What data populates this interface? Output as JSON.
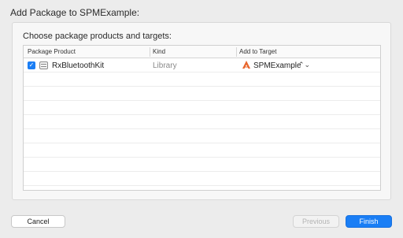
{
  "window": {
    "title": "Add Package to SPMExample:"
  },
  "panel": {
    "heading": "Choose package products and targets:"
  },
  "table": {
    "columns": {
      "product": "Package Product",
      "kind": "Kind",
      "target": "Add to Target"
    },
    "rows": [
      {
        "checked": true,
        "checkbox_glyph": "✓",
        "product": "RxBluetoothKit",
        "product_icon": "package-icon",
        "kind": "Library",
        "target": "SPMExample",
        "target_icon": "swift-icon",
        "target_stepper": "⌃⌄"
      }
    ],
    "empty_row_count_visible": 9
  },
  "buttons": {
    "cancel": "Cancel",
    "previous": "Previous",
    "finish": "Finish"
  },
  "colors": {
    "accent": "#1a7ef5",
    "swift": "#e8652b",
    "background": "#ececec"
  }
}
